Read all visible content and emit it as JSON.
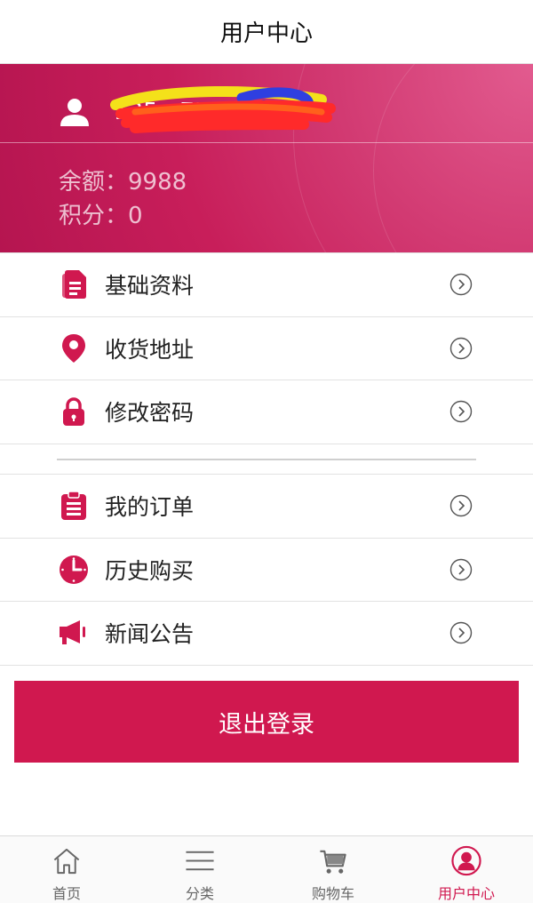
{
  "header": {
    "title": "用户中心"
  },
  "profile": {
    "username": "135...75",
    "balance_text": "余额：9988",
    "points_text": "积分：0"
  },
  "menu_group_1": [
    {
      "label": "基础资料",
      "icon": "document-icon"
    },
    {
      "label": "收货地址",
      "icon": "location-pin-icon"
    },
    {
      "label": "修改密码",
      "icon": "lock-icon"
    }
  ],
  "menu_group_2": [
    {
      "label": "我的订单",
      "icon": "clipboard-icon"
    },
    {
      "label": "历史购买",
      "icon": "clock-icon"
    },
    {
      "label": "新闻公告",
      "icon": "megaphone-icon"
    }
  ],
  "logout_label": "退出登录",
  "tabbar": [
    {
      "label": "首页",
      "icon": "home-icon",
      "active": false
    },
    {
      "label": "分类",
      "icon": "menu-lines-icon",
      "active": false
    },
    {
      "label": "购物车",
      "icon": "cart-icon",
      "active": false
    },
    {
      "label": "用户中心",
      "icon": "user-circle-icon",
      "active": true
    }
  ],
  "colors": {
    "accent": "#d0184f",
    "profile_bg": "#c81e5a"
  }
}
